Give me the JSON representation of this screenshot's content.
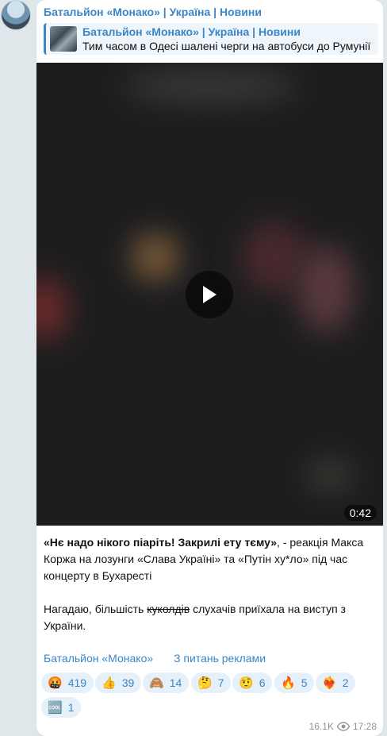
{
  "channel": {
    "name": "Батальйон «Монако» | Україна | Новини"
  },
  "forwarded": {
    "title": "Батальйон «Монако» | Україна | Новини",
    "text": "Тим часом в Одесі шалені черги на автобуси до Румунії"
  },
  "video": {
    "duration": "0:42"
  },
  "message": {
    "bold_quote": "«Нє надо нікого піаріть! Закрилі ету тєму»",
    "line1_rest": ", - реакція Макса Коржа на лозунги «Слава Україні» та «Путін ху*ло» під час концерту в Бухаресті",
    "line2_start": "Нагадаю, більшість ",
    "line2_strike": "куколдів",
    "line2_end": " слухачів приїхала на виступ з України."
  },
  "links": {
    "channel_link": "Батальйон «Монако»",
    "ads_link": "З питань реклами"
  },
  "reactions": [
    {
      "emoji": "🤬",
      "count": "419"
    },
    {
      "emoji": "👍",
      "count": "39"
    },
    {
      "emoji": "🙈",
      "count": "14"
    },
    {
      "emoji": "🤔",
      "count": "7"
    },
    {
      "emoji": "🤨",
      "count": "6"
    },
    {
      "emoji": "🔥",
      "count": "5"
    },
    {
      "emoji": "❤‍🔥",
      "count": "2"
    },
    {
      "emoji": "🆒",
      "count": "1"
    }
  ],
  "meta": {
    "views": "16.1K",
    "time": "17:28"
  },
  "colors": {
    "accent": "#3a86c7",
    "background": "#dfe7ea",
    "reaction_bg": "#e6f0f8"
  }
}
